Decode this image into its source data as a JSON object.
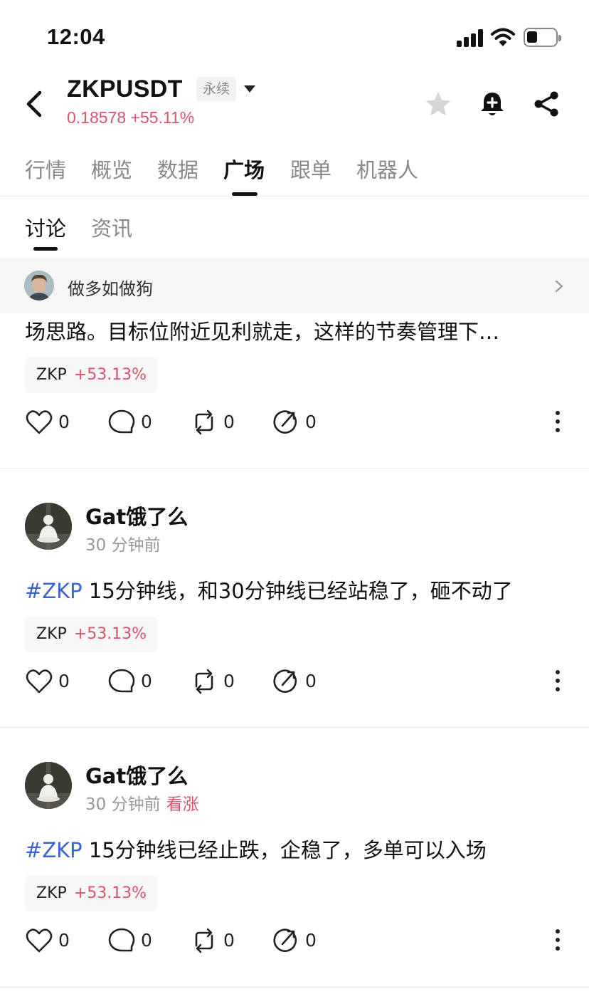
{
  "status_bar": {
    "time": "12:04"
  },
  "header": {
    "symbol": "ZKPUSDT",
    "contract_type": "永续",
    "price_line": "0.18578 +55.11%"
  },
  "tabs": [
    {
      "label": "行情"
    },
    {
      "label": "概览"
    },
    {
      "label": "数据"
    },
    {
      "label": "广场",
      "active": true
    },
    {
      "label": "跟单"
    },
    {
      "label": "机器人"
    }
  ],
  "subtabs": [
    {
      "label": "讨论",
      "active": true
    },
    {
      "label": "资讯"
    }
  ],
  "pinned_user": {
    "name": "做多如做狗"
  },
  "posts": [
    {
      "text": "场思路。目标位附近见利就走，这样的节奏管理下…",
      "chip": {
        "symbol": "ZKP",
        "change": "+53.13%"
      },
      "likes": "0",
      "comments": "0",
      "reposts": "0",
      "shares": "0"
    },
    {
      "author": "Gat饿了么",
      "time": "30 分钟前",
      "tag": "#ZKP",
      "text": " 15分钟线，和30分钟线已经站稳了，砸不动了",
      "chip": {
        "symbol": "ZKP",
        "change": "+53.13%"
      },
      "likes": "0",
      "comments": "0",
      "reposts": "0",
      "shares": "0"
    },
    {
      "author": "Gat饿了么",
      "time": "30 分钟前",
      "sentiment": "看涨",
      "tag": "#ZKP",
      "text": " 15分钟线已经止跌，企稳了，多单可以入场",
      "chip": {
        "symbol": "ZKP",
        "change": "+53.13%"
      },
      "likes": "0",
      "comments": "0",
      "reposts": "0",
      "shares": "0"
    }
  ],
  "colors": {
    "up": "#d9546a",
    "hashtag": "#3a63d8",
    "muted": "#888888"
  }
}
